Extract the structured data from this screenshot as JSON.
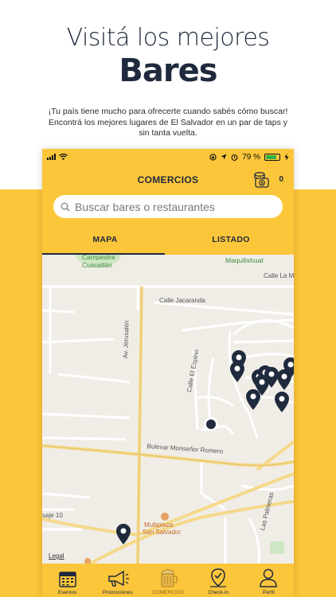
{
  "hero": {
    "title": "Visitá los mejores",
    "bold": "Bares",
    "description": "¡Tu país tiene mucho para ofrecerte cuando sabés cómo buscar! Encontrá los mejores lugares de El Salvador en un par de taps y sin tanta vuelta."
  },
  "status_bar": {
    "battery_percent": "79 %",
    "icons": [
      "signal-icon",
      "wifi-icon",
      "rotation-lock-icon",
      "location-icon",
      "alarm-icon",
      "battery-icon",
      "charging-icon"
    ]
  },
  "header": {
    "title": "COMERCIOS",
    "wallet_count": "0"
  },
  "search": {
    "placeholder": "Buscar bares o restaurantes"
  },
  "tabs": [
    {
      "label": "MAPA",
      "active": true
    },
    {
      "label": "LISTADO",
      "active": false
    }
  ],
  "map": {
    "labels": {
      "campestre": "Campestre",
      "cuscatlan": "Cuscatlán",
      "maquilishuat": "Maquilishuat",
      "calle_la_m": "Calle La M",
      "calle_jacaranda": "Calle Jacaranda",
      "av_jerusalen": "Av. Jerusalén",
      "calle_el_espino": "Calle El Espino",
      "bulevar": "Bulevar Monseñor Romero",
      "multiplaza": "Multiplaza",
      "san_salvador": "San Salvador",
      "las_palmeras": "Las Palmeras",
      "pasaje_10": "saje 10",
      "legal": "Legal"
    }
  },
  "tabbar": [
    {
      "label": "Eventos",
      "icon": "calendar-icon"
    },
    {
      "label": "Promociones",
      "icon": "megaphone-icon"
    },
    {
      "label": "COMERCIOS",
      "icon": "beer-mug-icon",
      "active": true
    },
    {
      "label": "Check-in",
      "icon": "map-pin-check-icon"
    },
    {
      "label": "Perfil",
      "icon": "user-icon"
    }
  ],
  "colors": {
    "accent": "#fcc63a",
    "dark": "#1f2a3d",
    "map_bg": "#f0ede7"
  }
}
